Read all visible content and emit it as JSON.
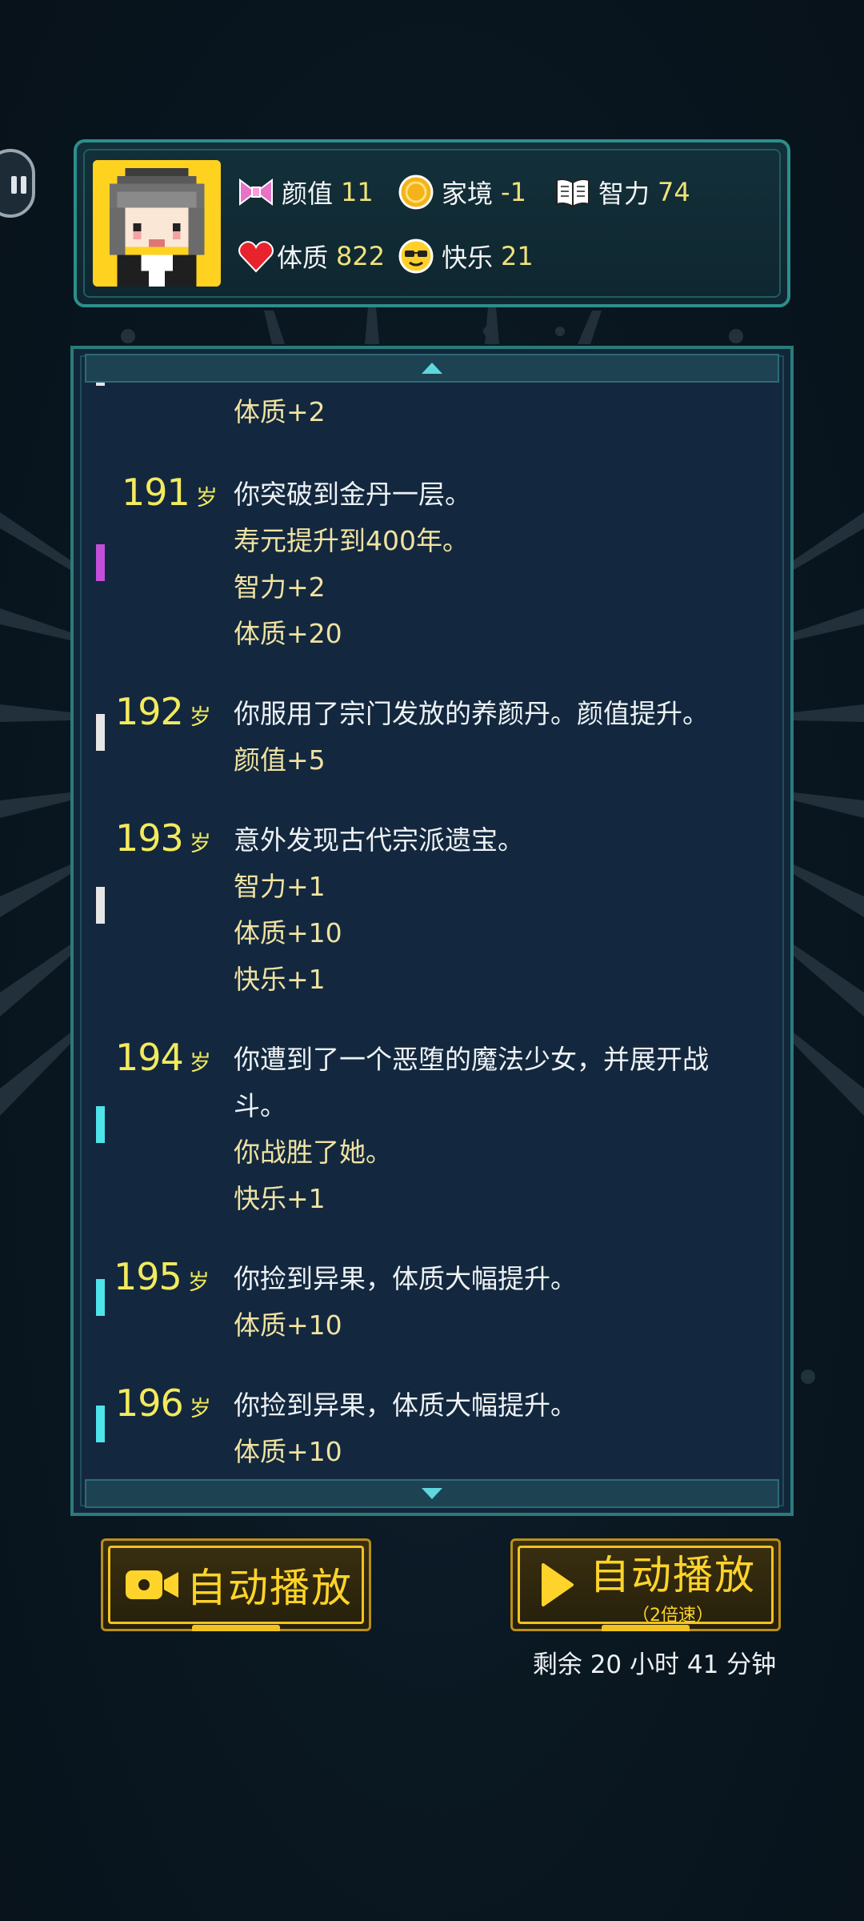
{
  "stats": {
    "appearance": {
      "label": "颜值",
      "value": "11"
    },
    "family": {
      "label": "家境",
      "value": "-1"
    },
    "intelligence": {
      "label": "智力",
      "value": "74"
    },
    "constitution": {
      "label": "体质",
      "value": "822"
    },
    "happiness": {
      "label": "快乐",
      "value": "21"
    }
  },
  "log": {
    "top_partial": {
      "effects": [
        "体质+2"
      ]
    },
    "entries": [
      {
        "age": "191",
        "unit": "岁",
        "lines": [
          "你突破到金丹一层。",
          "寿元提升到400年。"
        ],
        "effects": [
          "智力+2",
          "体质+20"
        ],
        "marker": "#c14fd9"
      },
      {
        "age": "192",
        "unit": "岁",
        "lines": [
          "你服用了宗门发放的养颜丹。颜值提升。"
        ],
        "effects": [
          "颜值+5"
        ],
        "marker": "#e6e6e6"
      },
      {
        "age": "193",
        "unit": "岁",
        "lines": [
          "意外发现古代宗派遗宝。"
        ],
        "effects": [
          "智力+1",
          "体质+10",
          "快乐+1"
        ],
        "marker": "#e6e6e6"
      },
      {
        "age": "194",
        "unit": "岁",
        "lines": [
          "你遭到了一个恶堕的魔法少女，并展开战",
          "斗。",
          "你战胜了她。"
        ],
        "effects": [
          "快乐+1"
        ],
        "marker": "#4fe3ea"
      },
      {
        "age": "195",
        "unit": "岁",
        "lines": [
          "你捡到异果，体质大幅提升。"
        ],
        "effects": [
          "体质+10"
        ],
        "marker": "#4fe3ea"
      },
      {
        "age": "196",
        "unit": "岁",
        "lines": [
          "你捡到异果，体质大幅提升。"
        ],
        "effects": [
          "体质+10"
        ],
        "marker": "#4fe3ea"
      }
    ]
  },
  "buttons": {
    "autoplay": {
      "label": "自动播放"
    },
    "autoplay_fast": {
      "label": "自动播放",
      "sub": "（2倍速）"
    }
  },
  "remaining_time": "剩余 20 小时 41 分钟",
  "colors": {
    "accent_gold": "#ffd42a",
    "age_yellow": "#f3ea5e",
    "panel_border": "#2a7c7b"
  }
}
